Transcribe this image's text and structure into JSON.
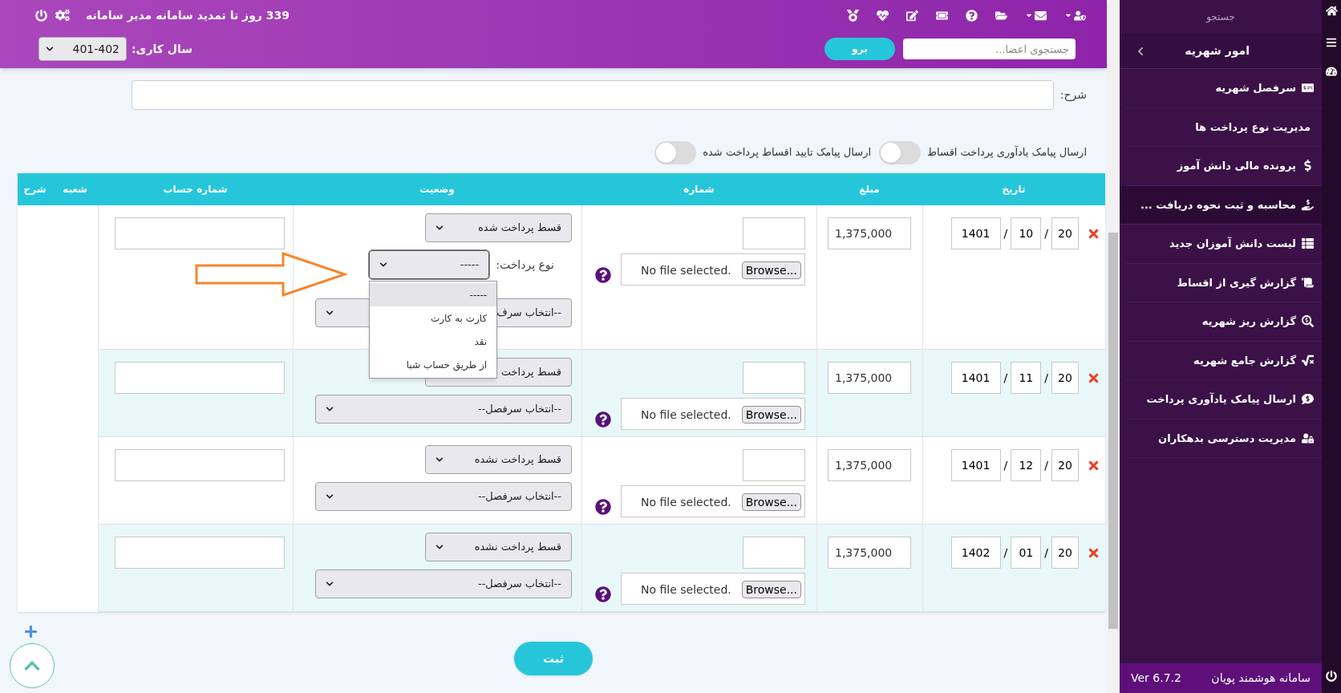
{
  "topbar": {
    "notice": "339 روز تا تمدید سامانه مدیر سامانه",
    "year_label": "سال کاری:",
    "year_value": "401-402",
    "search": {
      "placeholder": "جستجوی اعضا..."
    },
    "go_button": "برو"
  },
  "description": {
    "label": "شرح:"
  },
  "toggles": [
    {
      "label": "ارسال پیامک یادآوری پرداخت اقساط",
      "on": false
    },
    {
      "label": "ارسال پیامک تایید اقساط پرداخت شده",
      "on": false
    }
  ],
  "table": {
    "columns": [
      "تاریخ",
      "مبلغ",
      "شماره",
      "وضعیت",
      "شماره حساب",
      "شعبه",
      "شرح"
    ],
    "rows": [
      {
        "date": [
          "20",
          "10",
          "1401"
        ],
        "date_separators": [
          "/",
          "/"
        ],
        "amount": "1,375,000",
        "status": "قسط پرداخت شده",
        "payment_type": {
          "label": "نوع پرداخت:",
          "value": "-----",
          "expanded": true,
          "options": [
            {
              "label": "-----",
              "selected": true
            },
            {
              "label": "کارت به کارت",
              "selected": false
            },
            {
              "label": "نقد",
              "selected": false
            },
            {
              "label": "از طریق حساب شبا",
              "selected": false
            }
          ]
        },
        "heading_select": "--انتخاب سرف",
        "file_button": "Browse...",
        "file_status": "No file selected."
      },
      {
        "date": [
          "20",
          "11",
          "1401"
        ],
        "date_separators": [
          "/",
          "/"
        ],
        "amount": "1,375,000",
        "status": "قسط پرداخت",
        "heading_select": "--انتخاب سرفصل--",
        "file_button": "Browse...",
        "file_status": "No file selected."
      },
      {
        "date": [
          "20",
          "12",
          "1401"
        ],
        "date_separators": [
          "/",
          "/"
        ],
        "amount": "1,375,000",
        "status": "قسط پرداخت نشده",
        "heading_select": "--انتخاب سرفصل--",
        "file_button": "Browse...",
        "file_status": "No file selected."
      },
      {
        "date": [
          "20",
          "01",
          "1402"
        ],
        "date_separators": [
          "/",
          "/"
        ],
        "amount": "1,375,000",
        "status": "قسط پرداخت نشده",
        "heading_select": "--انتخاب سرفصل--",
        "file_button": "Browse...",
        "file_status": "No file selected."
      }
    ]
  },
  "submit_button": "ثبت",
  "sidebar": {
    "search_label": "جستجو",
    "section": "امور شهریه",
    "items": [
      {
        "label": "سرفصل شهریه",
        "selected": false
      },
      {
        "label": "مدیریت نوع پرداخت ها",
        "selected": false
      },
      {
        "label": "پرونده مالی دانش آموز",
        "selected": false
      },
      {
        "label": "محاسبه و ثبت نحوه دریافت ...",
        "selected": true
      },
      {
        "label": "لیست دانش آموزان جدید",
        "selected": false
      },
      {
        "label": "گزارش گیری از اقساط",
        "selected": false
      },
      {
        "label": "گزارش ریز شهریه",
        "selected": false
      },
      {
        "label": "گزارش جامع شهریه",
        "selected": false
      },
      {
        "label": "ارسال پیامک یادآوری پرداخت",
        "selected": false
      },
      {
        "label": "مدیریت دسترسی بدهکاران",
        "selected": false
      }
    ],
    "footer_title": "سامانه هوشمند پویان",
    "version": "Ver 6.7.2"
  }
}
